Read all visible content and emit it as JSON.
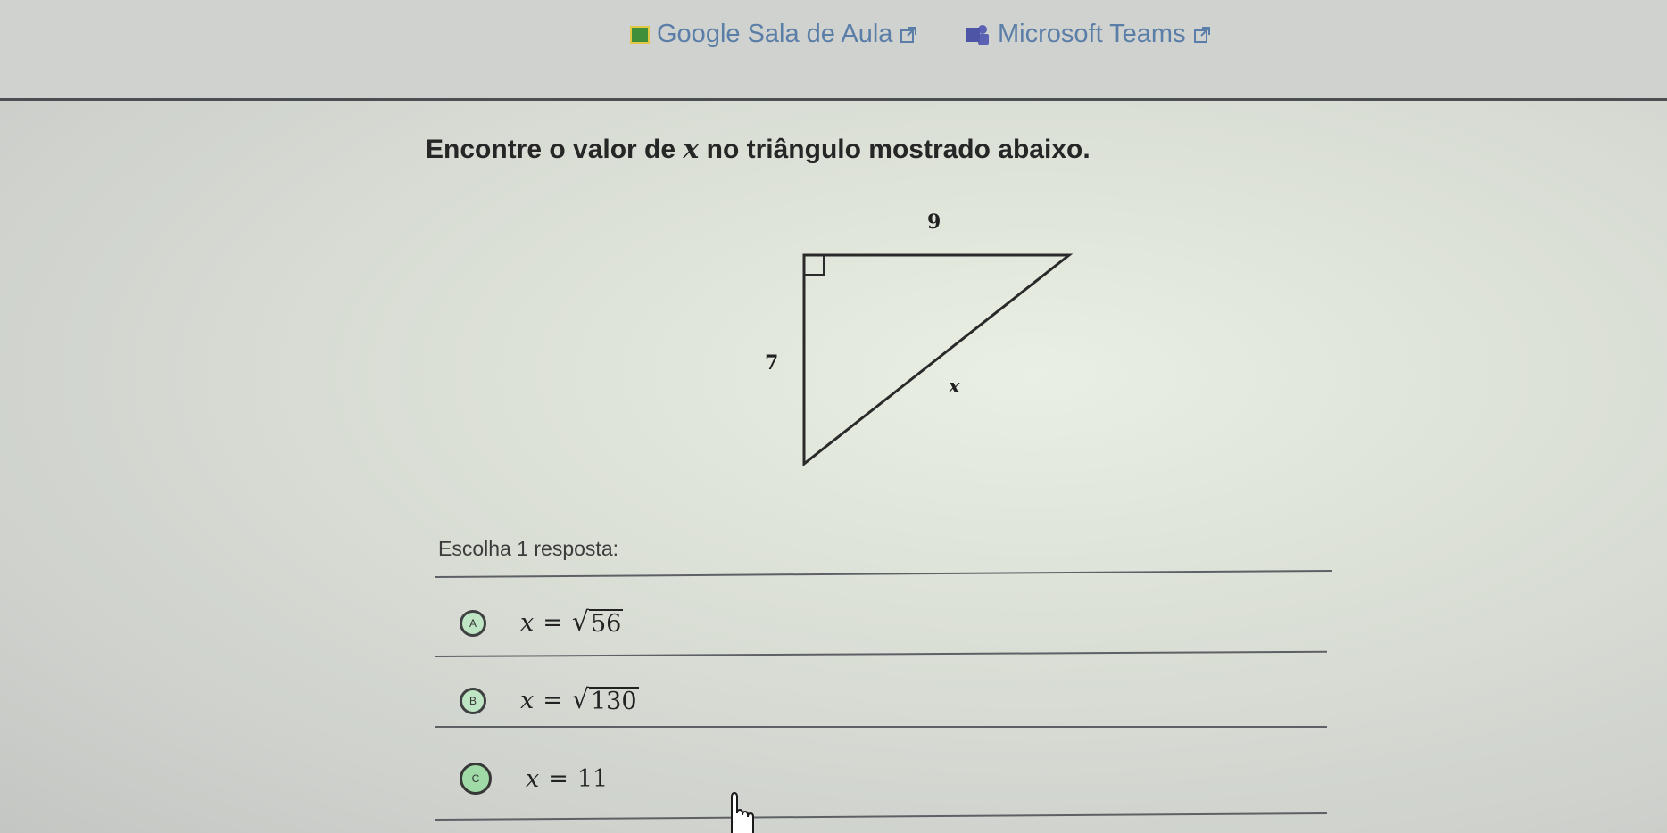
{
  "top_links": {
    "google_classroom": "Google Sala de Aula",
    "microsoft_teams": "Microsoft Teams"
  },
  "question": {
    "prefix": "Encontre o valor de ",
    "variable": "x",
    "suffix": " no triângulo mostrado abaixo."
  },
  "triangle": {
    "top_leg": "9",
    "left_leg": "7",
    "hypotenuse": "x"
  },
  "answers": {
    "prompt": "Escolha 1 resposta:",
    "options": [
      {
        "letter": "A",
        "variable": "x",
        "equals": "=",
        "radicand": "56"
      },
      {
        "letter": "B",
        "variable": "x",
        "equals": "=",
        "radicand": "130"
      },
      {
        "letter": "C",
        "variable": "x",
        "equals": "=",
        "value": "11"
      }
    ]
  },
  "colors": {
    "link": "#5a7ea8",
    "radio_fill": "#9fdaa7",
    "text": "#262626"
  }
}
